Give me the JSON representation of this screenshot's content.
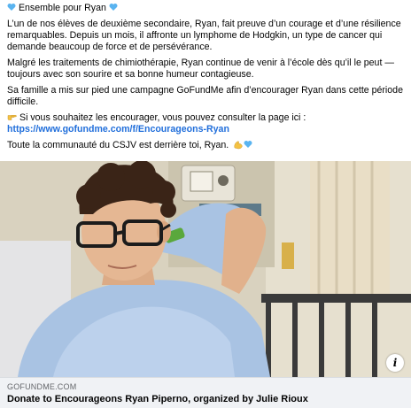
{
  "post": {
    "header_text": "Ensemble pour Ryan",
    "paragraph1_line1": "L’un de nos élèves de deuxième secondaire, Ryan, fait preuve d’un courage et d’une résilience",
    "paragraph1_line2": "remarquables. Depuis un mois, il affronte un lymphome de Hodgkin, un type de cancer qui",
    "paragraph1_line3": "demande beaucoup de force et de persévérance.",
    "paragraph2_line1": "Malgré les traitements de chimiothérapie, Ryan continue de venir à l’école dès qu’il le peut —",
    "paragraph2_line2": "toujours avec son sourire et sa bonne humeur contagieuse.",
    "paragraph3_line1": "Sa famille a mis sur pied une campagne GoFundMe afin d’encourager Ryan dans cette période",
    "paragraph3_line2": "difficile.",
    "encourage_text": "Si vous souhaitez les encourager, vous pouvez consulter la page ici :",
    "link_text": "https://www.gofundme.com/f/Encourageons-Ryan",
    "closing_text": "Toute la communauté du CSJV est derrière toi, Ryan.",
    "icons": {
      "heart": "blue-heart-icon",
      "pointer": "backhand-pointing-right-icon",
      "flex": "flexed-biceps-icon"
    },
    "colors": {
      "heart": "#5ab4f0",
      "link": "#216fdb",
      "preview_background": "#f0f2f5"
    }
  },
  "link_preview": {
    "domain": "GOFUNDME.COM",
    "title": "Donate to Encourageons Ryan Piperno, organized by Julie Rioux",
    "info_icon": "info-icon"
  }
}
